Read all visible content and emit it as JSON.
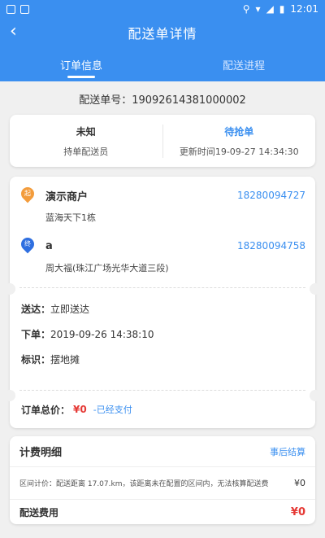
{
  "statusbar": {
    "time": "12:01"
  },
  "header": {
    "title": "配送单详情",
    "tabs": [
      {
        "label": "订单信息"
      },
      {
        "label": "配送进程"
      }
    ]
  },
  "order": {
    "number_text": "配送单号：19092614381000002"
  },
  "status": {
    "rider_value": "未知",
    "rider_label": "持单配送员",
    "state_value": "待抢单",
    "updated_text": "更新时间19-09-27 14:34:30"
  },
  "sender": {
    "badge": "起",
    "name": "演示商户",
    "phone": "18280094727",
    "address": "蓝海天下1栋"
  },
  "receiver": {
    "badge": "终",
    "name": "a",
    "phone": "18280094758",
    "address": "周大福(珠江广场光华大道三段)"
  },
  "info": [
    {
      "key": "送达：",
      "value": "立即送达"
    },
    {
      "key": "下单：",
      "value": "2019-09-26 14:38:10"
    },
    {
      "key": "标识：",
      "value": "摆地摊"
    }
  ],
  "total": {
    "label": "订单总价：",
    "amount": "¥0",
    "paid": "-已经支付"
  },
  "fees": {
    "title": "计费明细",
    "settle": "事后结算",
    "desc": "区间计价：配送距离 17.07.km，该距离未在配置的区间内，无法核算配送费",
    "desc_amount": "¥0",
    "line_label": "配送费用",
    "line_amount": "¥0"
  },
  "colors": {
    "primary": "#3a8ff0",
    "sender_pin": "#f39c3c",
    "receiver_pin": "#2f6fe0",
    "price": "#e53935"
  }
}
